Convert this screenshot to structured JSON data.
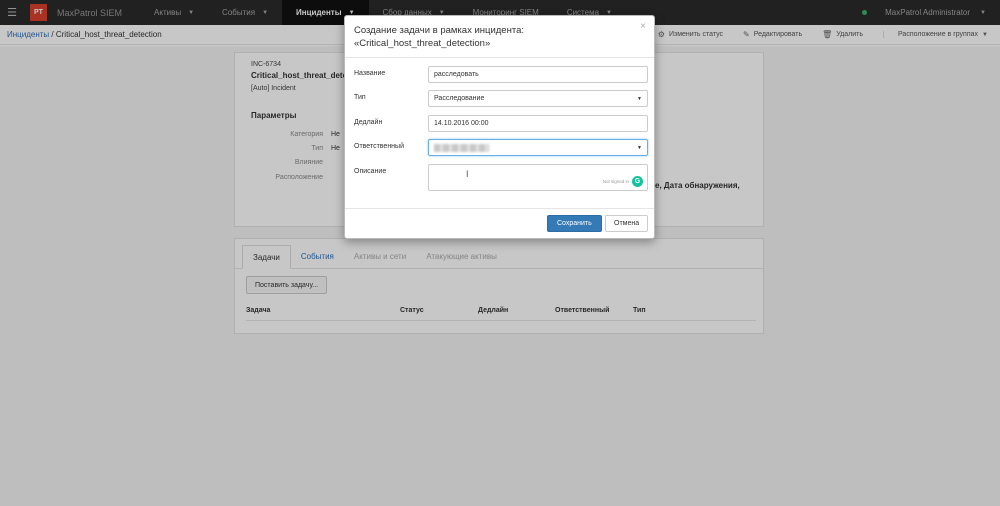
{
  "topbar": {
    "logo": "PT",
    "app_name": "MaxPatrol SIEM",
    "nav": [
      "Активы",
      "События",
      "Инциденты",
      "Сбор данных",
      "Мониторинг SIEM",
      "Система"
    ],
    "user": "MaxPatrol Administrator"
  },
  "breadcrumb": {
    "root": "Инциденты",
    "separator": " / ",
    "current": "Critical_host_threat_detection"
  },
  "actions": {
    "change_status": "Изменить статус",
    "edit": "Редактировать",
    "delete": "Удалить",
    "layout": "Расположение в группах"
  },
  "incident": {
    "id": "INC-6734",
    "name": "Critical_host_threat_detec",
    "type": "[Auto] Incident",
    "params_title": "Параметры",
    "params": [
      {
        "label": "Категория",
        "value": "Не"
      },
      {
        "label": "Тип",
        "value": "Не"
      },
      {
        "label": "Влияние",
        "value": ""
      },
      {
        "label": "Расположение",
        "value": ""
      }
    ],
    "side_text": "е, Дата обнаружения,"
  },
  "tabs": [
    "Задачи",
    "События",
    "Активы и сети",
    "Атакующие активы"
  ],
  "assign_button": "Поставить задачу...",
  "table_headers": [
    "Задача",
    "Статус",
    "Дедлайн",
    "Ответственный",
    "Тип"
  ],
  "modal": {
    "title_line1": "Создание задачи в рамках инцидента:",
    "title_line2": "«Critical_host_threat_detection»",
    "close": "×",
    "fields": {
      "name_label": "Название",
      "name_value": "расследовать",
      "type_label": "Тип",
      "type_value": "Расследование",
      "deadline_label": "Дедлайн",
      "deadline_value": "14.10.2016 00:00",
      "assignee_label": "Ответственный",
      "description_label": "Описание",
      "grammarly_text": "Not signed in",
      "grammarly_icon": "G"
    },
    "save": "Сохранить",
    "cancel": "Отмена"
  }
}
